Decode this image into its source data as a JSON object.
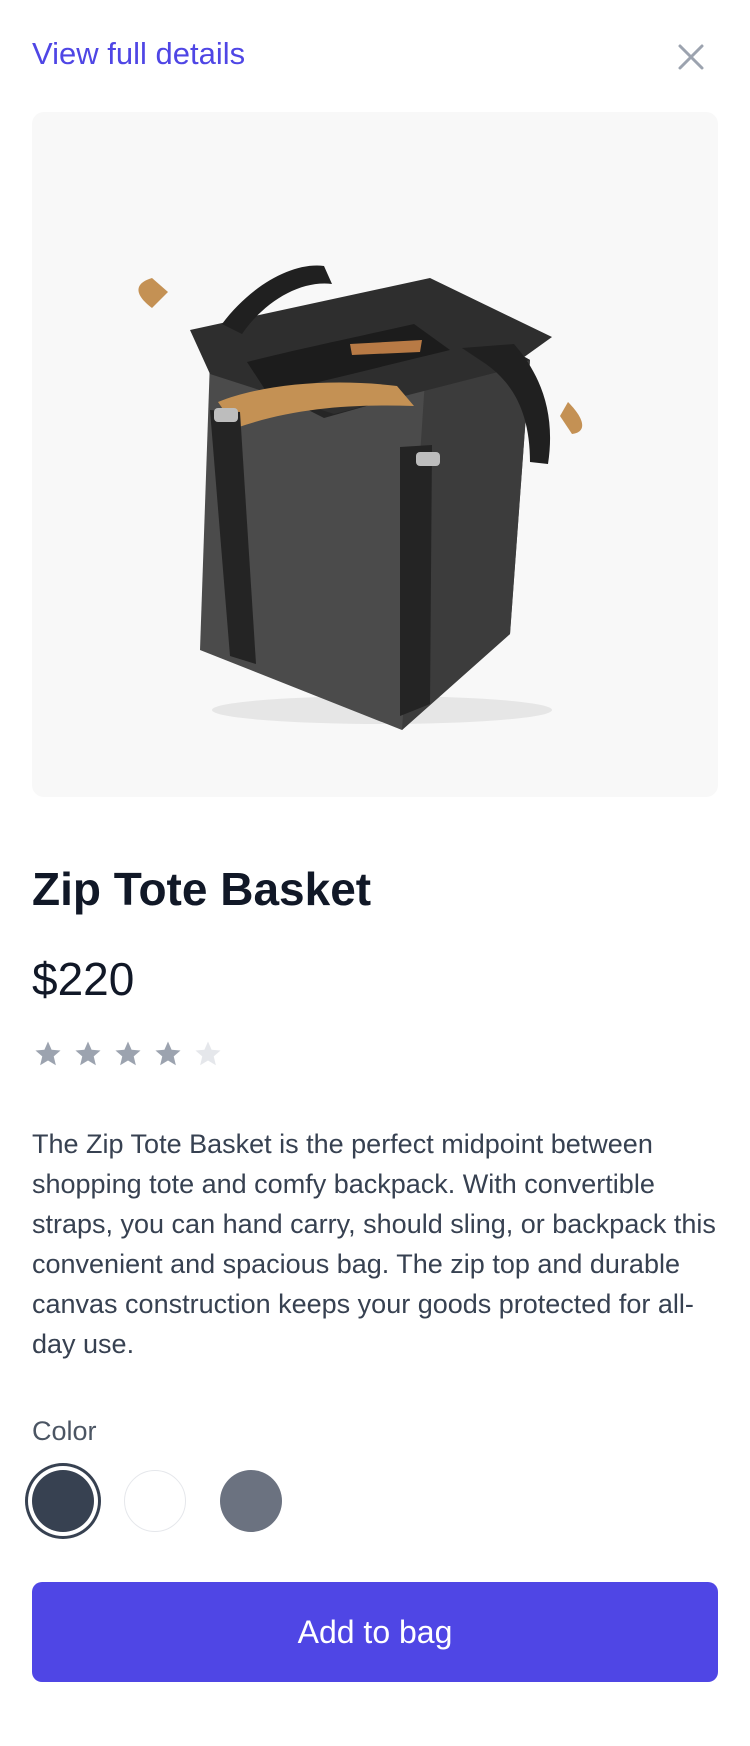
{
  "header": {
    "view_details_label": "View full details",
    "close_icon": "close-icon"
  },
  "product": {
    "image_alt": "Zip Tote Basket product photo",
    "name": "Zip Tote Basket",
    "price": "$220",
    "rating": {
      "value": 4,
      "max": 5,
      "filled_color": "#9ca3af",
      "empty_color": "#e5e7eb"
    },
    "description": "The Zip Tote Basket is the perfect midpoint between shopping tote and comfy backpack. With convertible straps, you can hand carry, should sling, or backpack this convenient and spacious bag. The zip top and durable canvas construction keeps your goods protected for all-day use."
  },
  "color_picker": {
    "label": "Color",
    "options": [
      {
        "hex": "#374151",
        "selected": true
      },
      {
        "hex": "#ffffff",
        "selected": false
      },
      {
        "hex": "#6b7280",
        "selected": false
      }
    ]
  },
  "actions": {
    "add_to_bag_label": "Add to bag",
    "accent_color": "#4f46e5"
  }
}
